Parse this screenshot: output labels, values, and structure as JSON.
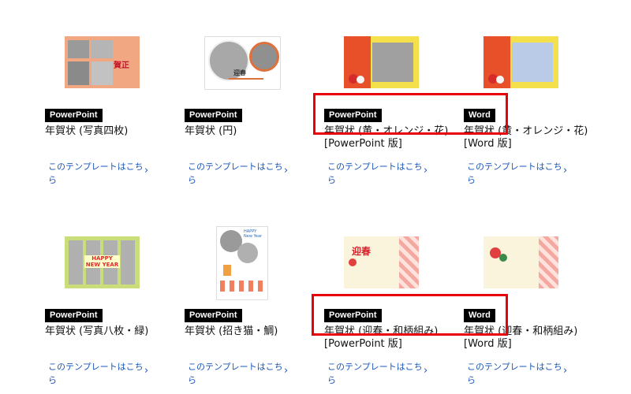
{
  "link_text": "このテンプレートはこちら",
  "cards": [
    {
      "badge": "PowerPoint",
      "title": "年賀状 (写真四枚)",
      "thumb_text": "賀正"
    },
    {
      "badge": "PowerPoint",
      "title": "年賀状 (円)",
      "thumb_text": "迎春"
    },
    {
      "badge": "PowerPoint",
      "title": "年賀状 (黄・オレンジ・花)[PowerPoint 版]"
    },
    {
      "badge": "Word",
      "title": "年賀状 (黄・オレンジ・花)[Word 版]"
    },
    {
      "badge": "PowerPoint",
      "title": "年賀状 (写真八枚・緑)",
      "thumb_text": "HAPPY NEW YEAR"
    },
    {
      "badge": "PowerPoint",
      "title": "年賀状 (招き猫・鯛)",
      "thumb_text": "HAPPY New Year"
    },
    {
      "badge": "PowerPoint",
      "title": "年賀状 (迎春・和柄組み)[PowerPoint 版]",
      "thumb_text": "迎春"
    },
    {
      "badge": "Word",
      "title": "年賀状 (迎春・和柄組み)[Word 版]"
    }
  ],
  "colors": {
    "link": "#1a56b8",
    "badge_bg": "#000000",
    "highlight": "#e8000b"
  }
}
